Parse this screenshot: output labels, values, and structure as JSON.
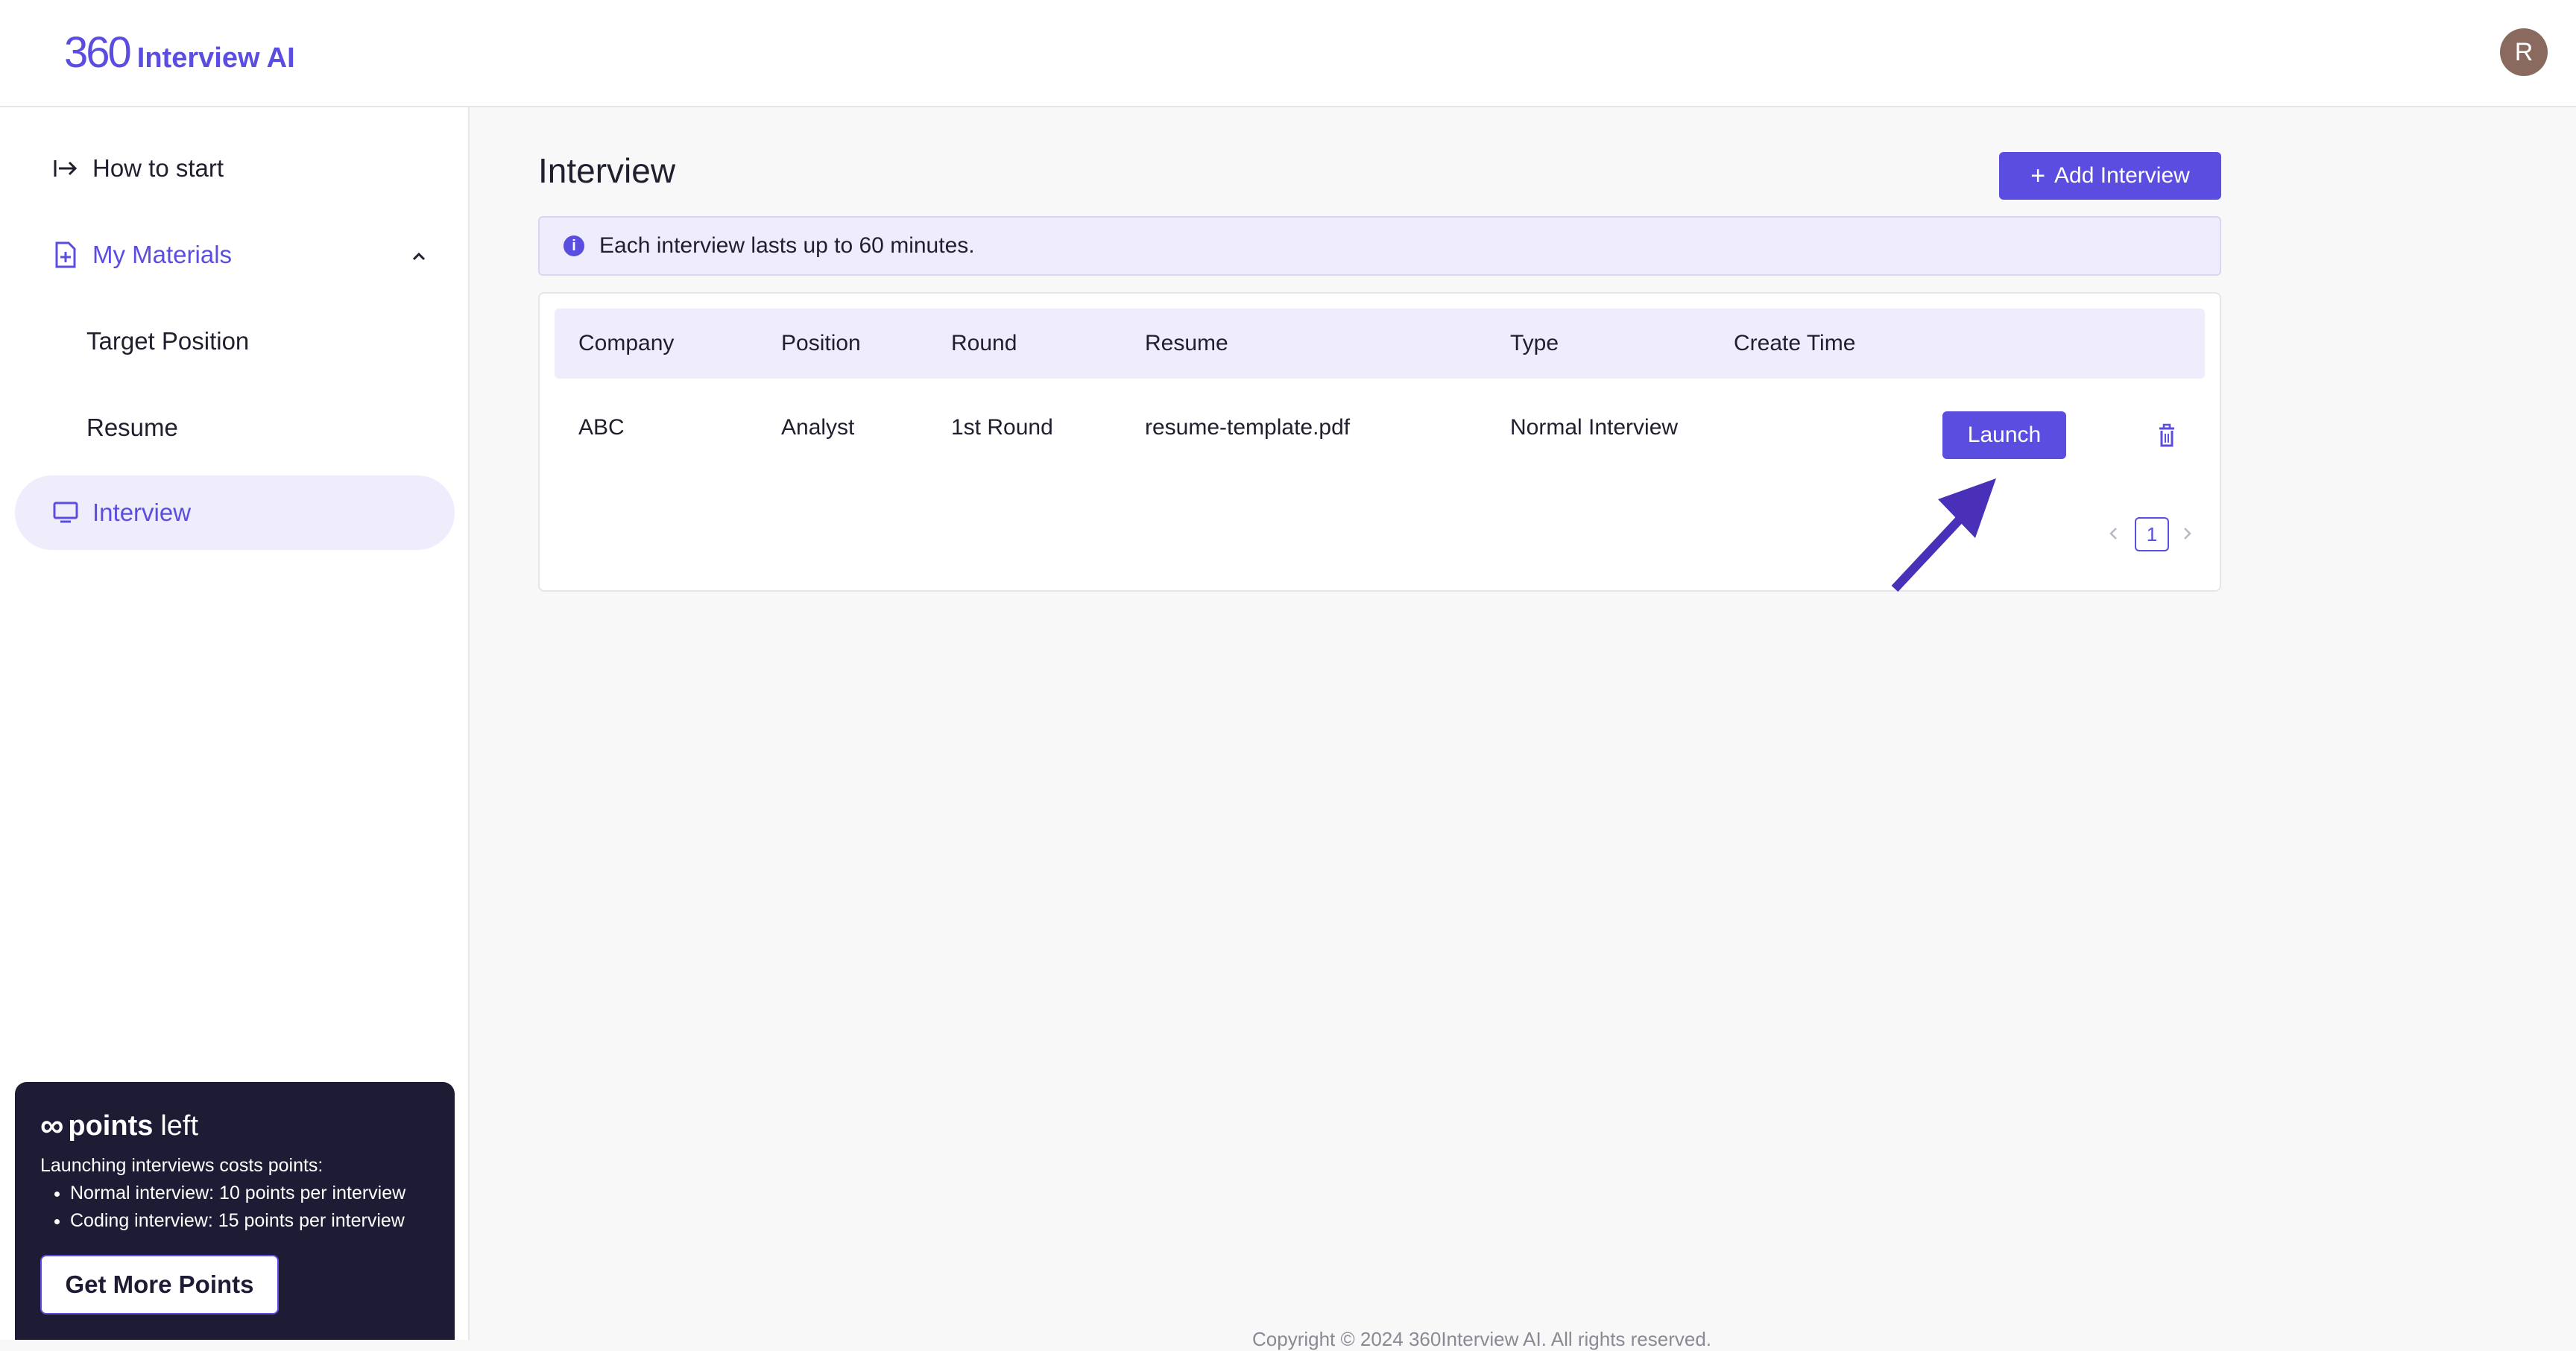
{
  "header": {
    "logo_mark": "360",
    "logo_text": "Interview AI",
    "avatar_initial": "R"
  },
  "sidebar": {
    "items": [
      {
        "label": "How to start",
        "icon": "arrow-right-to-line-icon"
      },
      {
        "label": "My Materials",
        "icon": "file-plus-icon",
        "expanded": true
      },
      {
        "label": "Target Position"
      },
      {
        "label": "Resume"
      },
      {
        "label": "Interview",
        "icon": "monitor-icon",
        "active": true
      }
    ]
  },
  "points": {
    "symbol": "∞",
    "label_bold": "points",
    "label_rest": "left",
    "description": "Launching interviews costs points:",
    "bullets": [
      "Normal interview: 10 points per interview",
      "Coding interview: 15 points per interview"
    ],
    "button_label": "Get More Points"
  },
  "main": {
    "title": "Interview",
    "add_button_label": "Add Interview",
    "info_text": "Each interview lasts up to 60 minutes.",
    "table": {
      "headers": [
        "Company",
        "Position",
        "Round",
        "Resume",
        "Type",
        "Create Time"
      ],
      "rows": [
        {
          "company": "ABC",
          "position": "Analyst",
          "round": "1st Round",
          "resume": "resume-template.pdf",
          "type": "Normal Interview",
          "create_time": "",
          "action_label": "Launch"
        }
      ]
    },
    "pagination": {
      "current_page": "1"
    }
  },
  "footer": {
    "text": "Copyright © 2024 360Interview AI. All rights reserved."
  },
  "colors": {
    "accent": "#5b4de0",
    "accent_light": "#efedfb",
    "card_dark": "#1d1c34",
    "arrow": "#4a2fb8"
  }
}
